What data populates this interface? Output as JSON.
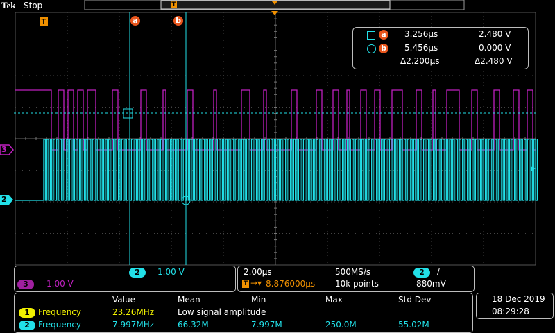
{
  "header": {
    "brand": "Tek",
    "run_state": "Stop"
  },
  "cursors": {
    "a_label": "a",
    "b_label": "b",
    "a_time": "3.256µs",
    "a_volt": "2.480 V",
    "b_time": "5.456µs",
    "b_volt": "0.000 V",
    "delta_time": "Δ2.200µs",
    "delta_volt": "Δ2.480 V"
  },
  "channels": {
    "ch2_marker": "2",
    "ch3_marker": "3",
    "trigger_marker": "T"
  },
  "vertical": {
    "ch2_badge": "2",
    "ch2_scale": "1.00 V",
    "ch3_badge": "3",
    "ch3_scale": "1.00 V"
  },
  "horizontal": {
    "time_div": "2.00µs",
    "sample_rate": "500MS/s",
    "trig_badge": "2",
    "trig_slope": "/",
    "trig_position": "8.876000µs",
    "record_length": "10k points",
    "trig_level": "880mV"
  },
  "measurements": {
    "headers": [
      "Value",
      "Mean",
      "Min",
      "Max",
      "Std Dev"
    ],
    "rows": [
      {
        "badge": "1",
        "label": "Frequency",
        "value": "23.26MHz",
        "mean": "Low signal amplitude",
        "min": "",
        "max": "",
        "std": ""
      },
      {
        "badge": "2",
        "label": "Frequency",
        "value": "7.997MHz",
        "mean": "66.32M",
        "min": "7.997M",
        "max": "250.0M",
        "std": "55.02M"
      }
    ]
  },
  "datetime": {
    "date": "18 Dec  2019",
    "time": "08:29:28"
  },
  "colors": {
    "ch1": "#f0f000",
    "ch2": "#22e0e8",
    "ch3": "#c020c0",
    "cursor_badge": "#e8551c",
    "trigger": "#f09000"
  }
}
